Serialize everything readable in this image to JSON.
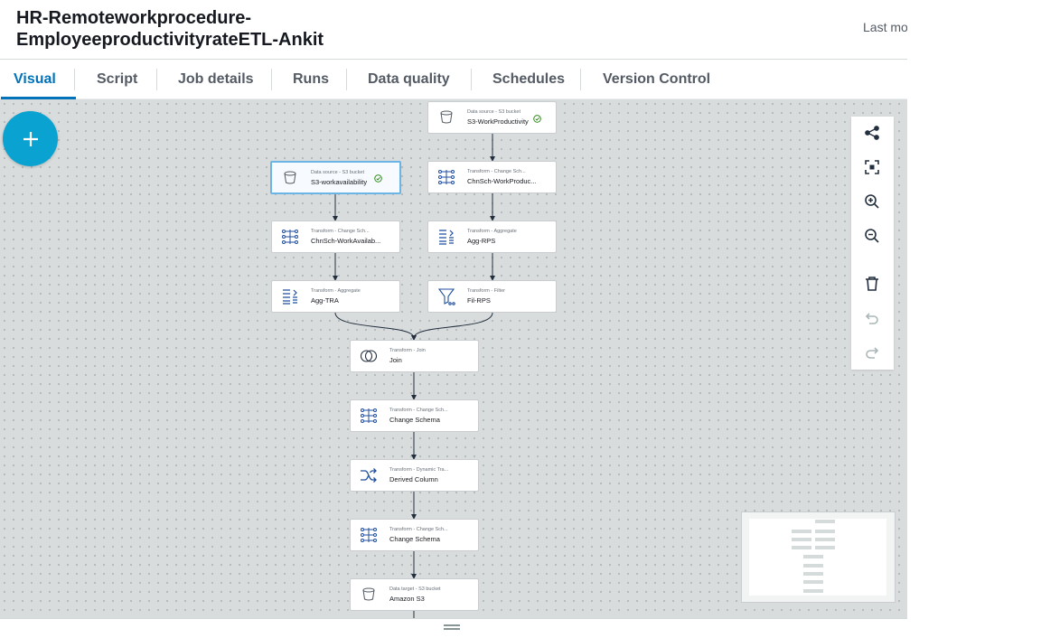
{
  "header": {
    "title_line1": "HR-Remoteworkprocedure-",
    "title_line2": "EmployeeproductivityrateETL-Ankit",
    "last_modified": "Last mo"
  },
  "tabs": [
    {
      "label": "Visual",
      "active": true
    },
    {
      "label": "Script",
      "active": false
    },
    {
      "label": "Job details",
      "active": false
    },
    {
      "label": "Runs",
      "active": false
    },
    {
      "label": "Data quality",
      "active": false
    },
    {
      "label": "Schedules",
      "active": false
    },
    {
      "label": "Version Control",
      "active": false
    }
  ],
  "nodes": {
    "s3_workproductivity": {
      "sub": "Data source - S3 bucket",
      "name": "S3-WorkProductivity",
      "icon": "bucket-icon",
      "status": "success"
    },
    "s3_workavailability": {
      "sub": "Data source - S3 bucket",
      "name": "S3-workavailability",
      "icon": "bucket-icon",
      "status": "success",
      "selected": true
    },
    "chnsch_workproductivity": {
      "sub": "Transform - Change Sch...",
      "name": "ChnSch-WorkProduc...",
      "icon": "change-schema-icon"
    },
    "chnsch_workavailability": {
      "sub": "Transform - Change Sch...",
      "name": "ChnSch-WorkAvailab...",
      "icon": "change-schema-icon"
    },
    "agg_rps": {
      "sub": "Transform - Aggregate",
      "name": "Agg-RPS",
      "icon": "aggregate-icon"
    },
    "agg_tra": {
      "sub": "Transform - Aggregate",
      "name": "Agg-TRA",
      "icon": "aggregate-icon"
    },
    "fil_rps": {
      "sub": "Transform - Filter",
      "name": "Fil-RPS",
      "icon": "filter-icon"
    },
    "join": {
      "sub": "Transform - Join",
      "name": "Join",
      "icon": "join-icon"
    },
    "change_schema_1": {
      "sub": "Transform - Change Sch...",
      "name": "Change Schema",
      "icon": "change-schema-icon"
    },
    "derived_column": {
      "sub": "Transform - Dynamic Tra...",
      "name": "Derived Column",
      "icon": "shuffle-icon"
    },
    "change_schema_2": {
      "sub": "Transform - Change Sch...",
      "name": "Change Schema",
      "icon": "change-schema-icon"
    },
    "amazon_s3": {
      "sub": "Data target - S3 bucket",
      "name": "Amazon S3",
      "icon": "bucket-icon"
    }
  },
  "toolbar": [
    "layout-icon",
    "fit-view-icon",
    "zoom-in-icon",
    "zoom-out-icon",
    "delete-icon",
    "undo-icon",
    "redo-icon"
  ],
  "colors": {
    "accent": "#0073bb",
    "add_button": "#0aa2d0",
    "success": "#1d8102",
    "icon_blue": "#1f4e9c"
  }
}
